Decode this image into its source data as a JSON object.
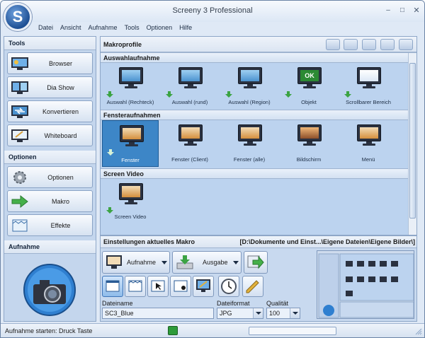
{
  "window": {
    "title": "Screeny 3 Professional",
    "logo_letter": "S",
    "controls": [
      "minimize-icon",
      "maximize-icon",
      "close-icon"
    ]
  },
  "menu": [
    "Datei",
    "Ansicht",
    "Aufnahme",
    "Tools",
    "Optionen",
    "Hilfe"
  ],
  "sidebar": {
    "tools_title": "Tools",
    "tools": [
      {
        "label": "Browser",
        "icon": "browser-icon"
      },
      {
        "label": "Dia Show",
        "icon": "slideshow-icon"
      },
      {
        "label": "Konvertieren",
        "icon": "convert-icon"
      },
      {
        "label": "Whiteboard",
        "icon": "whiteboard-icon"
      }
    ],
    "options_title": "Optionen",
    "options": [
      {
        "label": "Optionen",
        "icon": "gear-icon"
      },
      {
        "label": "Makro",
        "icon": "arrow-icon"
      },
      {
        "label": "Effekte",
        "icon": "effects-icon"
      }
    ],
    "capture_title": "Aufnahme",
    "capture_icon": "camera-icon"
  },
  "main": {
    "title": "Makroprofile",
    "header_tools": [
      "add-icon",
      "image-icon",
      "save-icon",
      "grid-icon",
      "export-icon"
    ],
    "groups": [
      {
        "title": "Auswahlaufnahme",
        "items": [
          {
            "label": "Auswahl (Rechteck)",
            "icon": "select-rectangle-icon"
          },
          {
            "label": "Auswahl (rund)",
            "icon": "select-round-icon"
          },
          {
            "label": "Auswahl (Region)",
            "icon": "select-region-icon"
          },
          {
            "label": "Objekt",
            "icon": "object-icon",
            "badge": "OK"
          },
          {
            "label": "Scrollbarer Bereich",
            "icon": "scroll-area-icon"
          }
        ]
      },
      {
        "title": "Fensteraufnahmen",
        "items": [
          {
            "label": "Fenster",
            "icon": "window-icon",
            "selected": true
          },
          {
            "label": "Fenster (Client)",
            "icon": "window-client-icon"
          },
          {
            "label": "Fenster (alle)",
            "icon": "window-all-icon"
          },
          {
            "label": "Bildschirm",
            "icon": "screen-icon"
          },
          {
            "label": "Menü",
            "icon": "menu-icon"
          }
        ]
      },
      {
        "title": "Screen Video",
        "items": [
          {
            "label": "Screen Video",
            "icon": "video-icon"
          }
        ]
      }
    ]
  },
  "settings": {
    "title": "Einstellungen aktuelles Makro",
    "path": "[D:\\Dokumente und Einst...\\Eigene Dateien\\Eigene Bilder\\]",
    "capture_button": "Aufnahme",
    "output_button": "Ausgabe",
    "filename_label": "Dateiname",
    "filename_value": "SC3_Blue",
    "format_label": "Dateiformat",
    "format_value": "JPG",
    "quality_label": "Qualität",
    "quality_value": "100"
  },
  "status": {
    "text": "Aufnahme starten: Druck Taste",
    "progress": 0.0
  }
}
